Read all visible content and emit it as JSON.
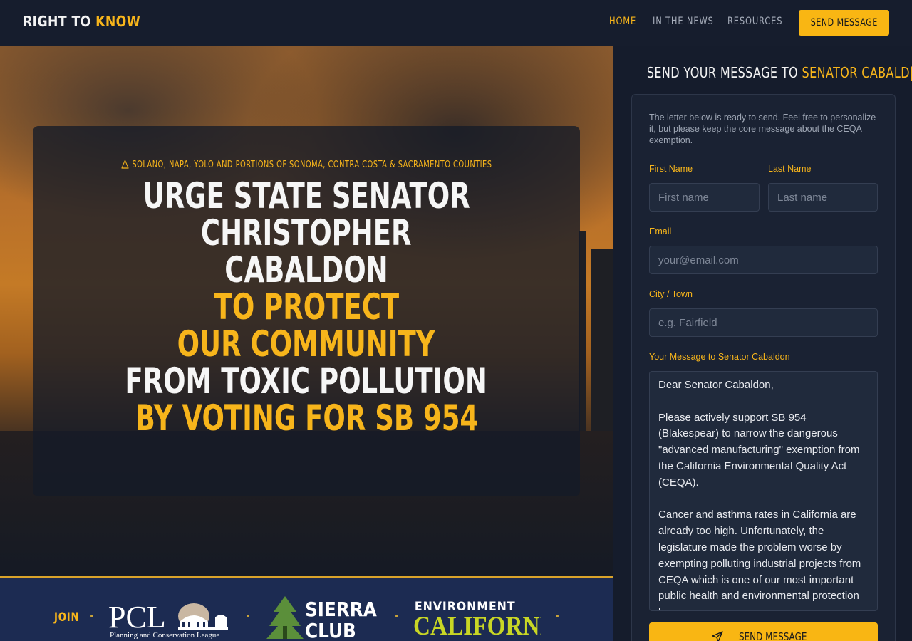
{
  "header": {
    "brand_part1": "RIGHT TO",
    "brand_part2": "KNOW",
    "nav": [
      {
        "label": "HOME",
        "active": true
      },
      {
        "label": "IN THE NEWS",
        "active": false
      },
      {
        "label": "RESOURCES",
        "active": false
      }
    ],
    "cta_label": "SEND MESSAGE"
  },
  "hero": {
    "region": "SOLANO, NAPA, YOLO AND PORTIONS OF SONOMA, CONTRA COSTA & SACRAMENTO COUNTIES",
    "region_icon": "warning-triangle-icon",
    "headline_lines": [
      {
        "text": "URGE STATE SENATOR",
        "color": "white"
      },
      {
        "text": "CHRISTOPHER",
        "color": "white"
      },
      {
        "text": "CABALDON",
        "color": "white"
      },
      {
        "text": "TO PROTECT",
        "color": "yellow"
      },
      {
        "text": "OUR COMMUNITY",
        "color": "yellow"
      },
      {
        "text": "FROM TOXIC POLLUTION",
        "color": "white"
      },
      {
        "text": "BY VOTING FOR SB 954",
        "color": "yellow"
      }
    ]
  },
  "partners": {
    "join_label": "JOIN",
    "logos": [
      {
        "name": "PCL",
        "tagline": "Planning and Conservation League"
      },
      {
        "name": "SIERRA CLUB"
      },
      {
        "name": "ENVIRONMENT CALIFORNIA"
      }
    ]
  },
  "form": {
    "title_part1": "SEND YOUR MESSAGE TO",
    "title_part2": "SENATOR CABALD|",
    "intro": "The letter below is ready to send. Feel free to personalize it, but please keep the core message about the CEQA exemption.",
    "first_name_label": "First Name",
    "first_name_placeholder": "First name",
    "last_name_label": "Last Name",
    "last_name_placeholder": "Last name",
    "email_label": "Email",
    "email_placeholder": "your@email.com",
    "city_label": "City / Town",
    "city_placeholder": "e.g. Fairfield",
    "message_label": "Your Message to Senator Cabaldon",
    "message_greeting": "Dear Senator Cabaldon,",
    "message_p1": "Please actively support SB 954 (Blakespear) to narrow the dangerous \"advanced manufacturing\" exemption from the California Environmental Quality Act (CEQA).",
    "message_p2": "Cancer and asthma rates in California are already too high. Unfortunately, the legislature made the problem worse by exempting polluting industrial projects from CEQA which is one of our most important public health and environmental protection laws.",
    "submit_label": "SEND MESSAGE",
    "submit_icon": "paper-plane-icon"
  },
  "colors": {
    "accent": "#f7b51b",
    "background": "#141b2b",
    "partners_bg": "#1c2b52"
  }
}
